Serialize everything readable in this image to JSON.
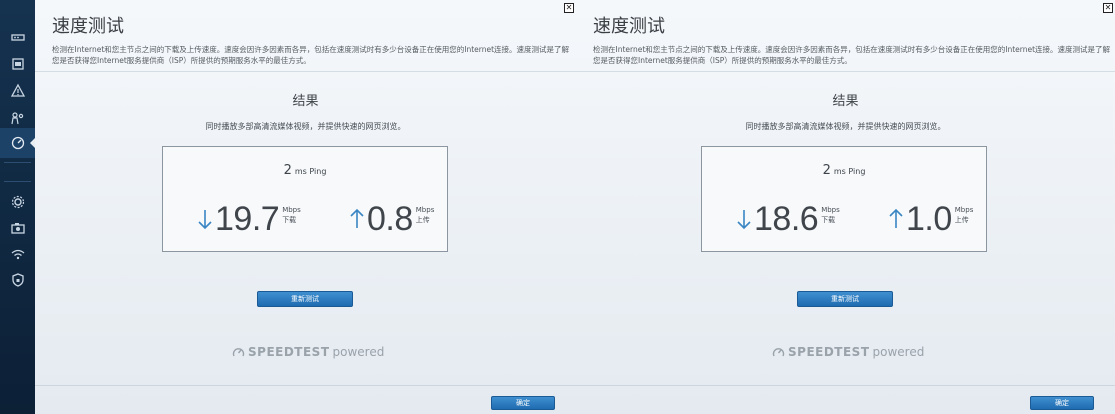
{
  "sidebar": {
    "items": [
      {
        "icon": "router-icon"
      },
      {
        "icon": "device-list-icon"
      },
      {
        "icon": "alert-icon"
      },
      {
        "icon": "parental-controls-icon"
      },
      {
        "icon": "speedtest-icon",
        "active": true
      },
      {
        "icon": "settings-gear-icon"
      },
      {
        "icon": "camera-icon"
      },
      {
        "icon": "wifi-icon"
      },
      {
        "icon": "security-shield-icon"
      }
    ]
  },
  "panels": [
    {
      "title": "速度测试",
      "description": "检测在Internet和您主节点之间的下载及上传速度。速度会因许多因素而各异，包括在速度测试时有多少台设备正在使用您的Internet连接。速度测试是了解您是否获得您Internet服务提供商（ISP）所提供的预期服务水平的最佳方式。",
      "result_heading": "结果",
      "result_sub": "同时播放多部高清流媒体视频，并提供快速的网页浏览。",
      "ping_value": "2",
      "ping_unit": "ms Ping",
      "download": {
        "value": "19.7",
        "unit": "Mbps",
        "label": "下载"
      },
      "upload": {
        "value": "0.8",
        "unit": "Mbps",
        "label": "上传"
      },
      "retest_label": "重新测试",
      "logo_brand": "SPEEDTEST",
      "logo_powered": "powered",
      "ok_label": "确定",
      "close_label": "✕"
    },
    {
      "title": "速度测试",
      "description": "检测在Internet和您主节点之间的下载及上传速度。速度会因许多因素而各异，包括在速度测试时有多少台设备正在使用您的Internet连接。速度测试是了解您是否获得您Internet服务提供商（ISP）所提供的预期服务水平的最佳方式。",
      "result_heading": "结果",
      "result_sub": "同时播放多部高清流媒体视频，并提供快速的网页浏览。",
      "ping_value": "2",
      "ping_unit": "ms Ping",
      "download": {
        "value": "18.6",
        "unit": "Mbps",
        "label": "下载"
      },
      "upload": {
        "value": "1.0",
        "unit": "Mbps",
        "label": "上传"
      },
      "retest_label": "重新测试",
      "logo_brand": "SPEEDTEST",
      "logo_powered": "powered",
      "ok_label": "确定",
      "close_label": "✕"
    }
  ],
  "colors": {
    "accent_arrow": "#3a86c4",
    "button": "#2a7cc0",
    "rail": "#12304c"
  }
}
